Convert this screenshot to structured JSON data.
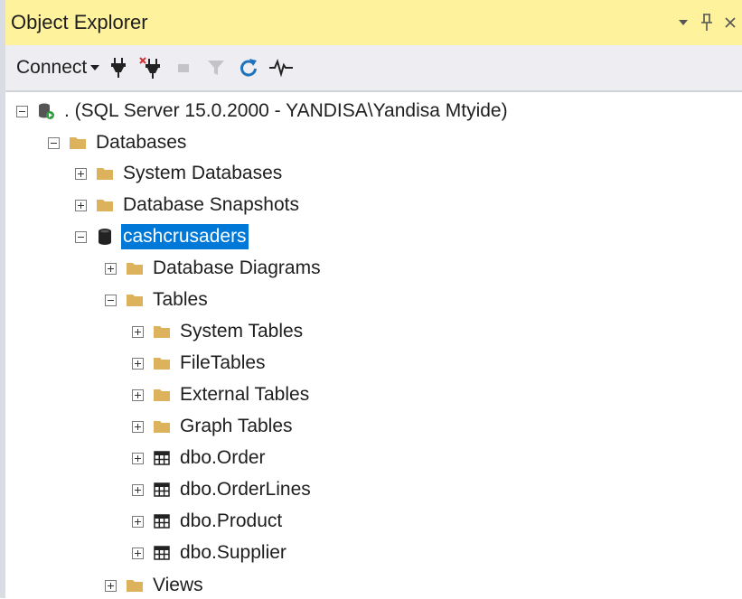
{
  "panel": {
    "title": "Object Explorer",
    "dropdown_glyph": "▾",
    "pin_glyph": "‡",
    "close_glyph": "×"
  },
  "toolbar": {
    "connect_label": "Connect",
    "connect_caret": "▾",
    "icons": [
      "connect-plug-icon",
      "disconnect-plug-icon",
      "stop-icon",
      "filter-icon",
      "refresh-icon",
      "activity-monitor-icon"
    ]
  },
  "tree": {
    "server": {
      "label": ". (SQL Server 15.0.2000 - YANDISA\\Yandisa Mtyide)",
      "icon": "server-icon",
      "expanded": true
    },
    "databases": {
      "label": "Databases",
      "icon": "folder-icon",
      "expanded": true
    },
    "system_databases": {
      "label": "System Databases",
      "icon": "folder-icon",
      "expanded": false
    },
    "database_snapshots": {
      "label": "Database Snapshots",
      "icon": "folder-icon",
      "expanded": false
    },
    "cashcrusaders": {
      "label": "cashcrusaders",
      "icon": "database-icon",
      "expanded": true,
      "selected": true
    },
    "database_diagrams": {
      "label": "Database Diagrams",
      "icon": "folder-icon",
      "expanded": false
    },
    "tables": {
      "label": "Tables",
      "icon": "folder-icon",
      "expanded": true
    },
    "system_tables": {
      "label": "System Tables",
      "icon": "folder-icon",
      "expanded": false
    },
    "filetables": {
      "label": "FileTables",
      "icon": "folder-icon",
      "expanded": false
    },
    "external_tables": {
      "label": "External Tables",
      "icon": "folder-icon",
      "expanded": false
    },
    "graph_tables": {
      "label": "Graph Tables",
      "icon": "folder-icon",
      "expanded": false
    },
    "dbo_order": {
      "label": "dbo.Order",
      "icon": "table-icon",
      "expanded": false
    },
    "dbo_orderlines": {
      "label": "dbo.OrderLines",
      "icon": "table-icon",
      "expanded": false
    },
    "dbo_product": {
      "label": "dbo.Product",
      "icon": "table-icon",
      "expanded": false
    },
    "dbo_supplier": {
      "label": "dbo.Supplier",
      "icon": "table-icon",
      "expanded": false
    },
    "views": {
      "label": "Views",
      "icon": "folder-icon",
      "expanded": false
    }
  },
  "colors": {
    "title_bar": "#fff29d",
    "toolbar": "#eeeef2",
    "selection": "#0078d7",
    "folder": "#dcb35c",
    "refresh_blue": "#1e73be"
  }
}
